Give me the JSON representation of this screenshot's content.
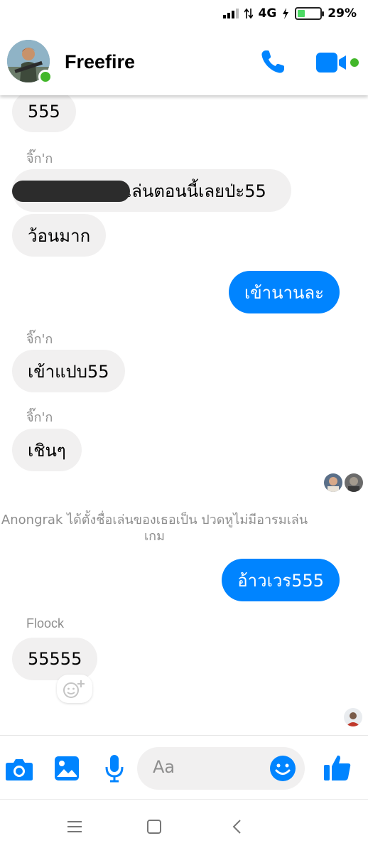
{
  "status_bar": {
    "network": "4G",
    "battery_percent": "29%",
    "battery_level": 0.29
  },
  "header": {
    "title": "Freefire",
    "avatar_icon": "group-avatar",
    "online": true,
    "call_icon": "phone-icon",
    "video_icon": "video-camera-icon"
  },
  "messages": [
    {
      "type": "incoming",
      "text": "555"
    },
    {
      "type": "sender",
      "text": "จิ๊ก'ก"
    },
    {
      "type": "incoming",
      "text": "เล่นตอนนี้เลยป่ะ55",
      "partially_redacted": true
    },
    {
      "type": "incoming",
      "text": "ว้อนมาก"
    },
    {
      "type": "outgoing",
      "text": "เข้านานละ"
    },
    {
      "type": "sender",
      "text": "จิ๊ก'ก"
    },
    {
      "type": "incoming",
      "text": "เข้าแปบ55"
    },
    {
      "type": "sender",
      "text": "จิ๊ก'ก"
    },
    {
      "type": "incoming",
      "text": "เชินๆ"
    },
    {
      "type": "system",
      "text": "Anongrak ได้ตั้งชื่อเล่นของเธอเป็น ปวดหูไม่มีอารมเล่นเกม"
    },
    {
      "type": "outgoing",
      "text": "อ้าวเวร555"
    },
    {
      "type": "sender",
      "text": "Floock"
    },
    {
      "type": "incoming",
      "text": "55555"
    }
  ],
  "composer": {
    "placeholder": "Aa",
    "tools": [
      "camera-icon",
      "image-icon",
      "microphone-icon"
    ],
    "emoji_icon": "smiley-icon",
    "send_icon": "thumbs-up-icon"
  },
  "colors": {
    "accent": "#0084ff",
    "incoming_bubble": "#f1f0f0",
    "online": "#42b72a",
    "muted_text": "#8e8e8e"
  }
}
